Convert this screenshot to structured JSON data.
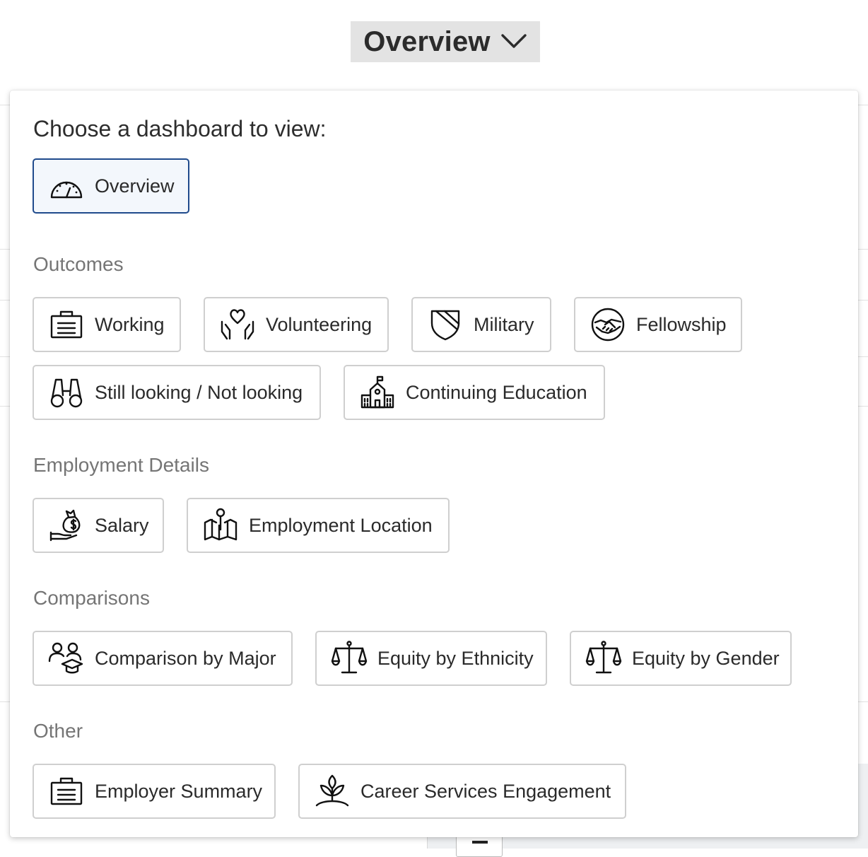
{
  "trigger": {
    "label": "Overview",
    "icon": "chevron-down-icon"
  },
  "panel": {
    "prompt": "Choose a dashboard to view:",
    "overview": {
      "label": "Overview",
      "icon": "speedometer-icon",
      "selected": true
    },
    "sections": [
      {
        "title": "Outcomes",
        "options": [
          {
            "label": "Working",
            "icon": "briefcase-icon"
          },
          {
            "label": "Volunteering",
            "icon": "heart-hands-icon"
          },
          {
            "label": "Military",
            "icon": "shield-icon"
          },
          {
            "label": "Fellowship",
            "icon": "handshake-icon"
          },
          {
            "label": "Still looking / Not looking",
            "icon": "binoculars-icon"
          },
          {
            "label": "Continuing Education",
            "icon": "school-building-icon"
          }
        ]
      },
      {
        "title": "Employment Details",
        "options": [
          {
            "label": "Salary",
            "icon": "money-bag-hand-icon"
          },
          {
            "label": "Employment Location",
            "icon": "map-pin-icon"
          }
        ]
      },
      {
        "title": "Comparisons",
        "options": [
          {
            "label": "Comparison by Major",
            "icon": "people-graduation-icon"
          },
          {
            "label": "Equity by Ethnicity",
            "icon": "scale-icon"
          },
          {
            "label": "Equity by Gender",
            "icon": "scale-icon"
          }
        ]
      },
      {
        "title": "Other",
        "options": [
          {
            "label": "Employer Summary",
            "icon": "briefcase-icon"
          },
          {
            "label": "Career Services Engagement",
            "icon": "sprout-icon"
          }
        ]
      }
    ]
  },
  "colors": {
    "selected_border": "#1f4a8c",
    "selected_fill": "#f3f7fc",
    "trigger_bg": "#e3e3e3",
    "section_heading": "#757575"
  }
}
